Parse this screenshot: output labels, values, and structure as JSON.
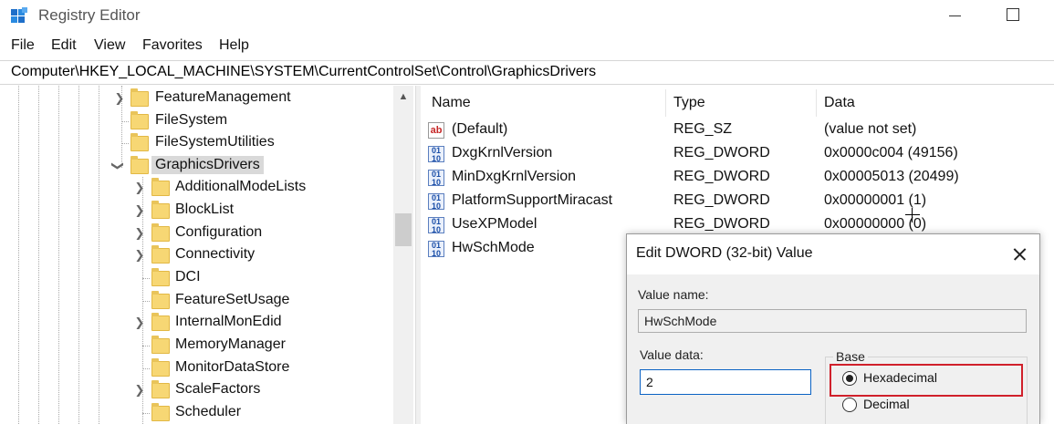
{
  "window": {
    "title": "Registry Editor"
  },
  "menu": [
    "File",
    "Edit",
    "View",
    "Favorites",
    "Help"
  ],
  "address": "Computer\\HKEY_LOCAL_MACHINE\\SYSTEM\\CurrentControlSet\\Control\\GraphicsDrivers",
  "tree": {
    "parent_items": [
      {
        "label": "FeatureManagement",
        "expandable": true
      },
      {
        "label": "FileSystem",
        "expandable": false
      },
      {
        "label": "FileSystemUtilities",
        "expandable": false
      },
      {
        "label": "GraphicsDrivers",
        "expandable": true,
        "expanded": true,
        "selected": true
      }
    ],
    "children": [
      {
        "label": "AdditionalModeLists",
        "expandable": true
      },
      {
        "label": "BlockList",
        "expandable": true
      },
      {
        "label": "Configuration",
        "expandable": true
      },
      {
        "label": "Connectivity",
        "expandable": true
      },
      {
        "label": "DCI",
        "expandable": false
      },
      {
        "label": "FeatureSetUsage",
        "expandable": false
      },
      {
        "label": "InternalMonEdid",
        "expandable": true
      },
      {
        "label": "MemoryManager",
        "expandable": false
      },
      {
        "label": "MonitorDataStore",
        "expandable": false
      },
      {
        "label": "ScaleFactors",
        "expandable": true
      },
      {
        "label": "Scheduler",
        "expandable": false
      }
    ]
  },
  "values": {
    "columns": {
      "name": "Name",
      "type": "Type",
      "data": "Data"
    },
    "rows": [
      {
        "name": "(Default)",
        "type": "REG_SZ",
        "data": "(value not set)",
        "icon": "string-value-icon"
      },
      {
        "name": "DxgKrnlVersion",
        "type": "REG_DWORD",
        "data": "0x0000c004 (49156)",
        "icon": "binary-value-icon"
      },
      {
        "name": "MinDxgKrnlVersion",
        "type": "REG_DWORD",
        "data": "0x00005013 (20499)",
        "icon": "binary-value-icon"
      },
      {
        "name": "PlatformSupportMiracast",
        "type": "REG_DWORD",
        "data": "0x00000001 (1)",
        "icon": "binary-value-icon"
      },
      {
        "name": "UseXPModel",
        "type": "REG_DWORD",
        "data": "0x00000000 (0)",
        "icon": "binary-value-icon"
      },
      {
        "name": "HwSchMode",
        "type": "",
        "data": "",
        "icon": "binary-value-icon"
      }
    ]
  },
  "dialog": {
    "title": "Edit DWORD (32-bit) Value",
    "value_name_label": "Value name:",
    "value_name": "HwSchMode",
    "value_data_label": "Value data:",
    "value_data": "2",
    "base_label": "Base",
    "hex_label": "Hexadecimal",
    "dec_label": "Decimal",
    "selected_base": "Hexadecimal",
    "highlight_color": "#d0202b"
  }
}
